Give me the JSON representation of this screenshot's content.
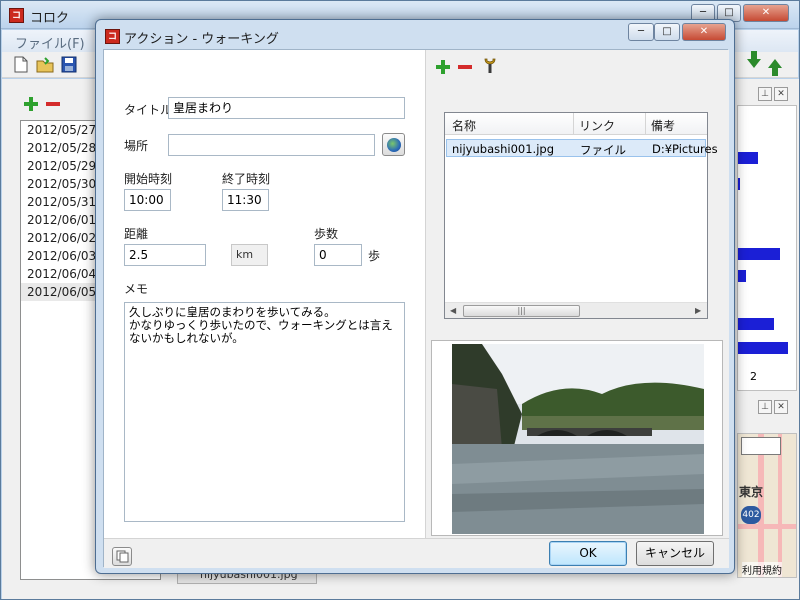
{
  "main_window": {
    "title": "コロク",
    "menu": {
      "file": "ファイル(F)"
    },
    "date_list": [
      {
        "date": "2012/05/27",
        "selected": false
      },
      {
        "date": "2012/05/28",
        "selected": false
      },
      {
        "date": "2012/05/29",
        "selected": false
      },
      {
        "date": "2012/05/30",
        "selected": false
      },
      {
        "date": "2012/05/31",
        "selected": false
      },
      {
        "date": "2012/06/01",
        "selected": false
      },
      {
        "date": "2012/06/02",
        "selected": false
      },
      {
        "date": "2012/06/03",
        "selected": false
      },
      {
        "date": "2012/06/04",
        "selected": false
      },
      {
        "date": "2012/06/05",
        "selected": true
      }
    ],
    "chart_axis_label": "2",
    "map": {
      "place_label": "東京",
      "route_badge": "402",
      "terms_link": "利用規約"
    },
    "status_file": "nijyubashi001.jpg"
  },
  "dialog": {
    "title": "アクション - ウォーキング",
    "title_label": "タイトル",
    "title_value": "皇居まわり",
    "place_label": "場所",
    "place_value": "",
    "start_label": "開始時刻",
    "start_value": "10:00",
    "end_label": "終了時刻",
    "end_value": "11:30",
    "distance_label": "距離",
    "distance_value": "2.5",
    "distance_unit": "km",
    "steps_label": "歩数",
    "steps_value": "0",
    "steps_unit": "歩",
    "memo_label": "メモ",
    "memo_text": "久しぶりに皇居のまわりを歩いてみる。\nかなりゆっくり歩いたので、ウォーキングとは言えないかもしれないが。",
    "attachments": {
      "columns": [
        "名称",
        "リンク",
        "備考"
      ],
      "rows": [
        {
          "name": "nijyubashi001.jpg",
          "link": "ファイル",
          "note": "D:¥Pictures"
        }
      ]
    },
    "ok_label": "OK",
    "cancel_label": "キャンセル"
  },
  "colors": {
    "add": "#2ea12e",
    "remove": "#d42b2b",
    "chart_bar": "#1b1fd6",
    "selection": "#dceaf9"
  },
  "icons": [
    "new-file-icon",
    "open-folder-icon",
    "save-icon",
    "add-icon",
    "remove-icon",
    "wrench-icon",
    "globe-icon",
    "copy-icon",
    "arrow-down-icon",
    "arrow-up-icon"
  ]
}
